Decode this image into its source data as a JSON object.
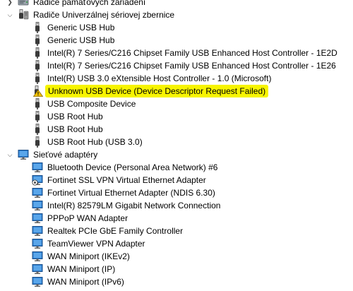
{
  "tree": {
    "memory_controllers": {
      "label": "Radiče pamäťových zariadení",
      "icon": "storage-controller-icon",
      "expanded": false
    },
    "usb_controllers": {
      "label": "Radiče Univerzálnej sériovej zbernice",
      "icon": "usb-controller-icon",
      "expanded": true,
      "devices": [
        {
          "label": "Generic USB Hub",
          "icon": "usb-plug-icon"
        },
        {
          "label": "Generic USB Hub",
          "icon": "usb-plug-icon"
        },
        {
          "label": "Intel(R) 7 Series/C216 Chipset Family USB Enhanced Host Controller - 1E2D",
          "icon": "usb-plug-icon"
        },
        {
          "label": "Intel(R) 7 Series/C216 Chipset Family USB Enhanced Host Controller - 1E26",
          "icon": "usb-plug-icon"
        },
        {
          "label": "Intel(R) USB 3.0 eXtensible Host Controller - 1.0 (Microsoft)",
          "icon": "usb-plug-icon"
        },
        {
          "label": "Unknown USB Device (Device Descriptor Request Failed)",
          "icon": "warning-icon",
          "highlight": "#f7f400"
        },
        {
          "label": "USB Composite Device",
          "icon": "usb-plug-icon"
        },
        {
          "label": "USB Root Hub",
          "icon": "usb-plug-icon"
        },
        {
          "label": "USB Root Hub",
          "icon": "usb-plug-icon"
        },
        {
          "label": "USB Root Hub (USB 3.0)",
          "icon": "usb-plug-icon"
        }
      ]
    },
    "network_adapters": {
      "label": "Sieťové adaptéry",
      "icon": "network-adapter-icon",
      "expanded": true,
      "devices": [
        {
          "label": "Bluetooth Device (Personal Area Network) #6",
          "icon": "network-adapter-icon"
        },
        {
          "label": "Fortinet SSL VPN Virtual Ethernet Adapter",
          "icon": "network-adapter-disabled-icon"
        },
        {
          "label": "Fortinet Virtual Ethernet Adapter (NDIS 6.30)",
          "icon": "network-adapter-icon"
        },
        {
          "label": "Intel(R) 82579LM Gigabit Network Connection",
          "icon": "network-adapter-icon"
        },
        {
          "label": "PPPoP WAN Adapter",
          "icon": "network-adapter-icon"
        },
        {
          "label": "Realtek PCIe GbE Family Controller",
          "icon": "network-adapter-icon"
        },
        {
          "label": "TeamViewer VPN Adapter",
          "icon": "network-adapter-icon"
        },
        {
          "label": "WAN Miniport (IKEv2)",
          "icon": "network-adapter-icon"
        },
        {
          "label": "WAN Miniport (IP)",
          "icon": "network-adapter-icon"
        },
        {
          "label": "WAN Miniport (IPv6)",
          "icon": "network-adapter-icon"
        }
      ]
    }
  },
  "colors": {
    "highlight": "#f7f400",
    "monitor_blue": "#2d7fd0",
    "warning_yellow": "#f2c200"
  }
}
